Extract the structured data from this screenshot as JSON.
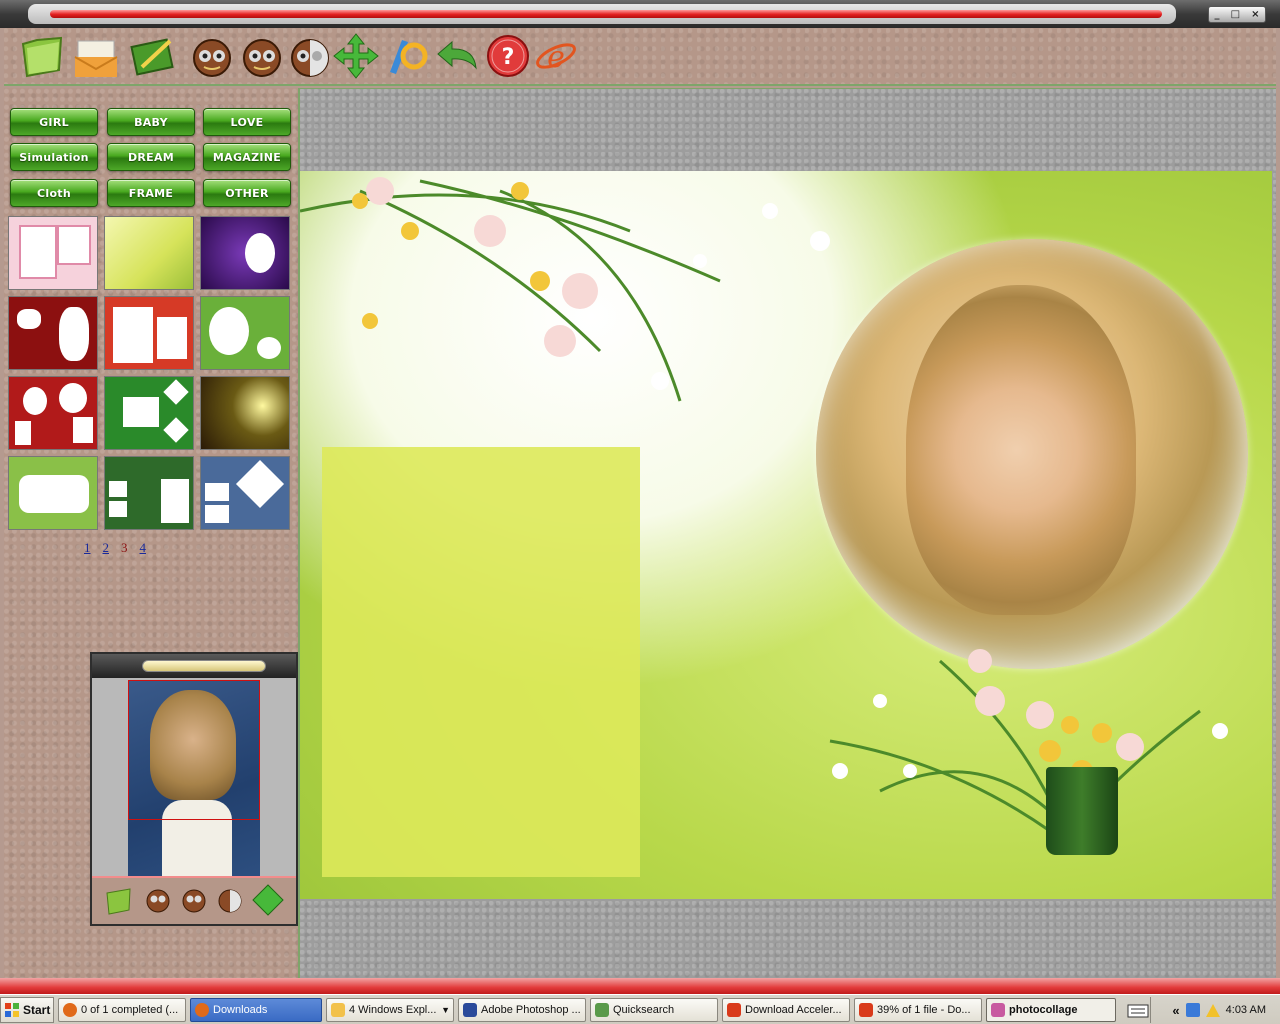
{
  "window": {
    "controls": [
      "_",
      "□",
      "×"
    ]
  },
  "toolbar": {
    "tools": [
      {
        "name": "open-folder-icon",
        "color": "#8bc53f"
      },
      {
        "name": "mail-icon",
        "color": "#f0a13b"
      },
      {
        "name": "edit-photo-icon",
        "color": "#5aa52a"
      },
      {
        "name": "mask-icon-1",
        "color": "#7b4a2a"
      },
      {
        "name": "mask-icon-2",
        "color": "#7b4a2a"
      },
      {
        "name": "mask-icon-3",
        "color": "#7b4a2a"
      },
      {
        "name": "move-arrows-icon",
        "color": "#47b83a"
      },
      {
        "name": "rotate-icon",
        "color": "#f4b324"
      },
      {
        "name": "undo-icon",
        "color": "#4ca83a"
      },
      {
        "name": "help-icon",
        "color": "#e13b3b"
      },
      {
        "name": "internet-explorer-icon",
        "color": "#e2551f"
      }
    ]
  },
  "categories": [
    {
      "label": "GIRL"
    },
    {
      "label": "BABY"
    },
    {
      "label": "LOVE"
    },
    {
      "label": "Simulation"
    },
    {
      "label": "DREAM"
    },
    {
      "label": "MAGAZINE"
    },
    {
      "label": "Cloth"
    },
    {
      "label": "FRAME"
    },
    {
      "label": "OTHER"
    }
  ],
  "templates": [
    {
      "name": "pink-frame",
      "color": "#f6d2dc"
    },
    {
      "name": "yellow-green",
      "color": "#d6e35a"
    },
    {
      "name": "purple-night",
      "color": "#5a2a8a"
    },
    {
      "name": "red-splash",
      "color": "#8c1010"
    },
    {
      "name": "red-torn",
      "color": "#d63a26"
    },
    {
      "name": "green-spots",
      "color": "#6ab03a"
    },
    {
      "name": "strawberries",
      "color": "#b11a1a"
    },
    {
      "name": "green-diamonds",
      "color": "#2a8a2a"
    },
    {
      "name": "dark-sunburst",
      "color": "#3a2a14"
    },
    {
      "name": "tulips",
      "color": "#8ac048"
    },
    {
      "name": "green-tiles",
      "color": "#2e6a2a"
    },
    {
      "name": "blue-mosaic",
      "color": "#4a6a9a"
    }
  ],
  "pager": {
    "pages": [
      "1",
      "2",
      "3",
      "4"
    ],
    "current": "3"
  },
  "taskbar": {
    "start": "Start",
    "items": [
      {
        "label": "0 of 1 completed (...",
        "color": "#e06a1a"
      },
      {
        "label": "Downloads",
        "color": "#e06a1a"
      },
      {
        "label": "4 Windows Expl...",
        "color": "#f2c14a"
      },
      {
        "label": "Adobe Photoshop ...",
        "color": "#2a4a9a"
      },
      {
        "label": "Quicksearch",
        "color": "#5a9a4a"
      },
      {
        "label": "Download Acceler...",
        "color": "#d93a1a"
      },
      {
        "label": "39% of 1 file - Do...",
        "color": "#d93a1a"
      },
      {
        "label": "photocollage",
        "color": "#c85aa0"
      }
    ],
    "time": "4:03 AM",
    "tray_chevron": "«"
  }
}
